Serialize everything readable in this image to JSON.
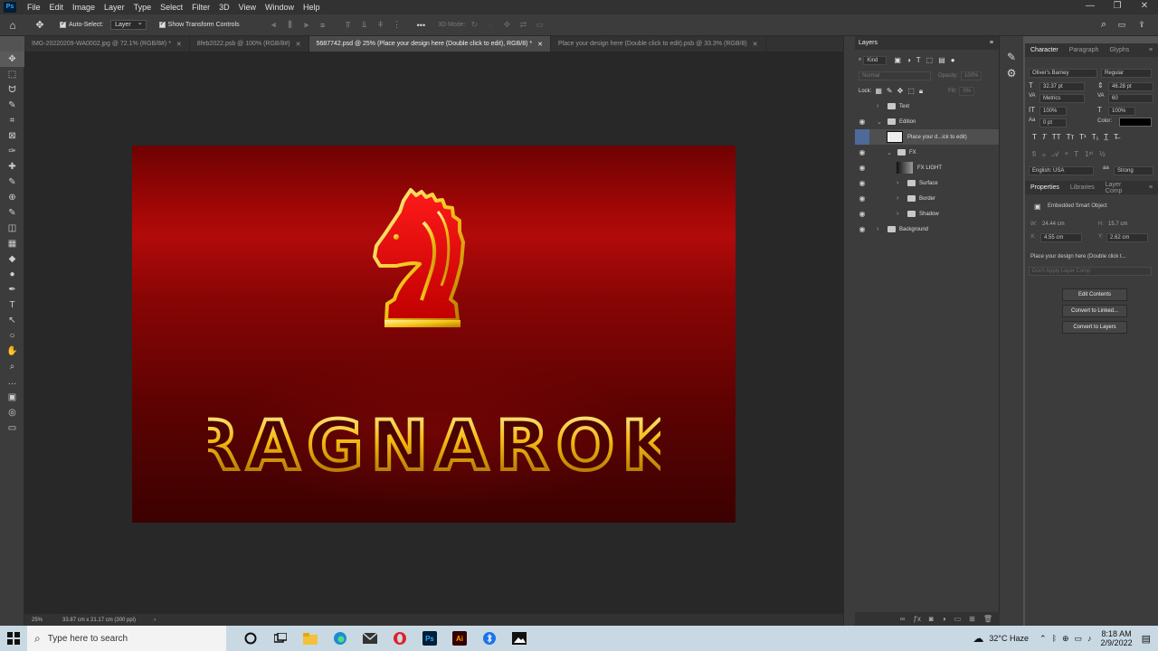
{
  "app": {
    "logo": "Ps",
    "menu": [
      "File",
      "Edit",
      "Image",
      "Layer",
      "Type",
      "Select",
      "Filter",
      "3D",
      "View",
      "Window",
      "Help"
    ],
    "window_controls": [
      "—",
      "❐",
      "✕"
    ]
  },
  "options_bar": {
    "auto_select_label": "Auto-Select:",
    "auto_select_value": "Layer",
    "show_transform_label": "Show Transform Controls",
    "three_d_mode_label": "3D Mode:",
    "more_label": "•••"
  },
  "tabs": [
    {
      "label": "IMG-20220209-WA0002.jpg @ 72.1% (RGB/8#) *",
      "active": false
    },
    {
      "label": "8feb2022.psb @ 100% (RGB/8#)",
      "active": false
    },
    {
      "label": "5687742.psd @ 25% (Place your design here (Double click to edit), RGB/8) *",
      "active": true
    },
    {
      "label": "Place your design here (Double click to edit).psb @ 33.3% (RGB/8)",
      "active": false
    }
  ],
  "tools": [
    "move-tool",
    "marquee-tool",
    "lasso-tool",
    "quick-select-tool",
    "crop-tool",
    "frame-tool",
    "eyedropper-tool",
    "healing-tool",
    "brush-tool",
    "stamp-tool",
    "history-brush-tool",
    "eraser-tool",
    "gradient-tool",
    "blur-tool",
    "dodge-tool",
    "pen-tool",
    "type-tool",
    "path-select-tool",
    "shape-tool",
    "hand-tool",
    "zoom-tool",
    "more-tools",
    "color-swatches",
    "quick-mask",
    "screen-mode"
  ],
  "tool_glyphs": [
    "✥",
    "⬚",
    "ᗢ",
    "✎",
    "⌗",
    "⊠",
    "✑",
    "✚",
    "✎",
    "⊕",
    "✎",
    "◫",
    "▦",
    "◆",
    "●",
    "✒",
    "T",
    "↖",
    "○",
    "✋",
    "⌕",
    "…",
    "▣",
    "◎",
    "▭"
  ],
  "canvas": {
    "title_text": "RAGNAROK",
    "doc_colors": {
      "red_bright": "#b10a0a",
      "red_dark": "#3c0101",
      "gold": "#f5c518"
    }
  },
  "status": {
    "zoom": "25%",
    "doc_size": "33.87 cm x 21.17 cm (300 ppi)"
  },
  "layers": {
    "panel_title": "Layers",
    "filter_kind": "Kind",
    "blend_mode": "Normal",
    "opacity_label": "Opacity:",
    "opacity_value": "100%",
    "lock_label": "Lock:",
    "fill_label": "Fill:",
    "fill_value": "0%",
    "items": [
      {
        "label": "Text",
        "type": "group",
        "visible": false,
        "indent": 0,
        "expanded": false
      },
      {
        "label": "Edition",
        "type": "group",
        "visible": true,
        "indent": 0,
        "expanded": true
      },
      {
        "label": "Place your d...ick to edit)",
        "type": "smart-object",
        "visible": false,
        "indent": 1,
        "selected": true
      },
      {
        "label": "FX",
        "type": "group",
        "visible": true,
        "indent": 1,
        "expanded": true
      },
      {
        "label": "FX LIGHT",
        "type": "layer",
        "visible": true,
        "indent": 2
      },
      {
        "label": "Surface",
        "type": "group",
        "visible": true,
        "indent": 2,
        "expanded": false
      },
      {
        "label": "Border",
        "type": "group",
        "visible": true,
        "indent": 2,
        "expanded": false
      },
      {
        "label": "Shadow",
        "type": "group",
        "visible": true,
        "indent": 2,
        "expanded": false
      },
      {
        "label": "Background",
        "type": "group",
        "visible": true,
        "indent": 0,
        "expanded": false
      }
    ]
  },
  "character": {
    "tabs": [
      "Character",
      "Paragraph",
      "Glyphs"
    ],
    "font_family": "Oliver's Barney",
    "font_style": "Regular",
    "font_size": "32.37 pt",
    "leading": "46.28 pt",
    "kerning": "Metrics",
    "tracking": "60",
    "vertical_scale": "100%",
    "horizontal_scale": "100%",
    "baseline_shift": "0 pt",
    "color_label": "Color:",
    "language": "English: USA",
    "antialias": "Strong"
  },
  "properties": {
    "tabs": [
      "Properties",
      "Libraries",
      "Layer Comp"
    ],
    "type_label": "Embedded Smart Object",
    "w_label": "W:",
    "w_value": "24.44 cm",
    "h_label": "H:",
    "h_value": "15.7 cm",
    "x_label": "X:",
    "x_value": "4.55 cm",
    "y_label": "Y:",
    "y_value": "2.62 cm",
    "object_name": "Place your design here (Double click t...",
    "layer_comp": "Don't Apply Layer Comp",
    "buttons": [
      "Edit Contents",
      "Convert to Linked...",
      "Convert to Layers"
    ]
  },
  "taskbar": {
    "search_placeholder": "Type here to search",
    "weather": "32°C  Haze",
    "time": "8:18 AM",
    "date": "2/9/2022"
  }
}
